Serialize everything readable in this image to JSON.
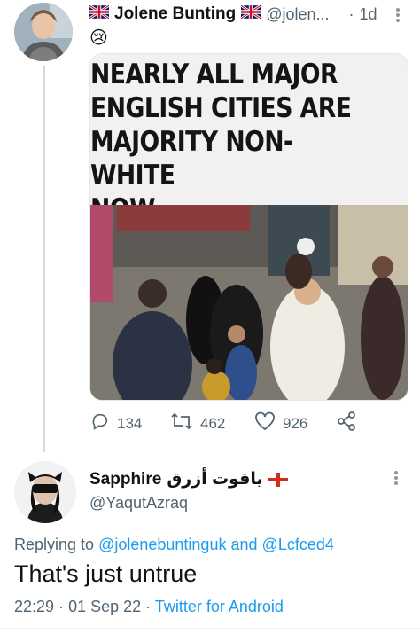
{
  "tweet": {
    "author_name": "Jolene Bunting",
    "author_flag_left": "uk-flag-icon",
    "author_flag_right": "uk-flag-icon",
    "handle": "@jolen...",
    "separator": "·",
    "time": "1d",
    "emoji": "😢",
    "image_headline": "NEARLY ALL MAJOR\nENGLISH CITIES ARE\nMAJORITY NON-WHITE\nNOW",
    "actions": {
      "reply_count": "134",
      "retweet_count": "462",
      "like_count": "926"
    }
  },
  "reply": {
    "author_name": "Sapphire",
    "author_name_arabic": "ياقوت أزرق",
    "author_flag": "england-flag-icon",
    "handle": "@YaqutAzraq",
    "replying_prefix": "Replying to",
    "replying_user1": "@jolenebuntinguk",
    "replying_and": "and",
    "replying_user2": "@Lcfced4",
    "text": "That's just untrue",
    "time": "22:29",
    "separator1": "·",
    "date": "01 Sep 22",
    "separator2": "·",
    "source": "Twitter for Android"
  },
  "colors": {
    "link": "#1d9bf0",
    "muted": "#536471",
    "text": "#0f1419",
    "thread_line": "#cfd9de"
  }
}
